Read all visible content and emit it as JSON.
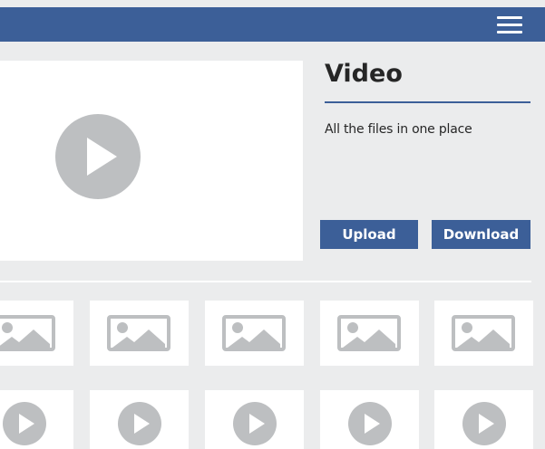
{
  "header": {
    "menu_icon": "hamburger-menu-icon",
    "color": "#3c5f98"
  },
  "player": {
    "icon": "play-icon"
  },
  "info": {
    "title": "Video",
    "description": "All the files in one place",
    "upload_label": "Upload",
    "download_label": "Download"
  },
  "gallery": {
    "image_tiles": [
      {
        "icon": "image-placeholder-icon"
      },
      {
        "icon": "image-placeholder-icon"
      },
      {
        "icon": "image-placeholder-icon"
      },
      {
        "icon": "image-placeholder-icon"
      },
      {
        "icon": "image-placeholder-icon"
      }
    ],
    "video_tiles": [
      {
        "icon": "play-icon"
      },
      {
        "icon": "play-icon"
      },
      {
        "icon": "play-icon"
      },
      {
        "icon": "play-icon"
      },
      {
        "icon": "play-icon"
      }
    ]
  },
  "colors": {
    "accent": "#3c5f98",
    "placeholder_gray": "#bdbfc1",
    "background": "#ebeced"
  }
}
